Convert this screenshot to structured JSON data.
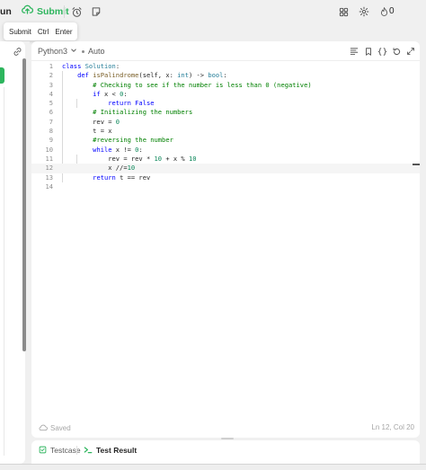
{
  "topbar": {
    "run_label": "un",
    "submit_label": "Submit",
    "count": "0",
    "icons": [
      "cloud-upload-icon",
      "alarm-clock-icon",
      "note-icon",
      "layout-icon",
      "gear-icon",
      "fire-icon"
    ]
  },
  "tooltip": {
    "label": "Submit",
    "key1": "Ctrl",
    "key2": "Enter"
  },
  "editor": {
    "language": "Python3",
    "mode": "Auto",
    "status_saved": "Saved",
    "cursor_position": "Ln 12, Col 20",
    "active_line": 12,
    "line_numbers": [
      "1",
      "2",
      "3",
      "4",
      "5",
      "6",
      "7",
      "8",
      "9",
      "10",
      "11",
      "12",
      "13",
      "14"
    ]
  },
  "bottom_tabs": {
    "testcase": "Testcase",
    "test_result": "Test Result"
  },
  "colors": {
    "accent_green": "#2db55d",
    "keyword": "#0000ff",
    "comment": "#008000",
    "number": "#098658"
  }
}
